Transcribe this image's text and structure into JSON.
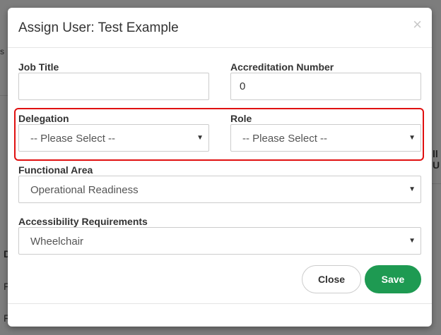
{
  "background": {
    "fragments": [
      "s",
      "ll U",
      "D",
      "F",
      "F"
    ]
  },
  "modal": {
    "title": "Assign User: Test Example",
    "close_glyph": "×"
  },
  "fields": {
    "job_title": {
      "label": "Job Title",
      "value": ""
    },
    "accreditation_number": {
      "label": "Accreditation Number",
      "value": "0"
    },
    "delegation": {
      "label": "Delegation",
      "value": "-- Please Select --"
    },
    "role": {
      "label": "Role",
      "value": "-- Please Select --"
    },
    "functional_area": {
      "label": "Functional Area",
      "value": "Operational Readiness"
    },
    "accessibility": {
      "label": "Accessibility Requirements",
      "value": "Wheelchair"
    }
  },
  "buttons": {
    "close_label": "Close",
    "save_label": "Save"
  },
  "icons": {
    "caret": "▼",
    "close": "close-icon",
    "dropdown": "chevron-down-icon"
  },
  "colors": {
    "primary": "#1e9a52",
    "highlight": "#e01010",
    "backdrop": "#7d7d7d"
  }
}
